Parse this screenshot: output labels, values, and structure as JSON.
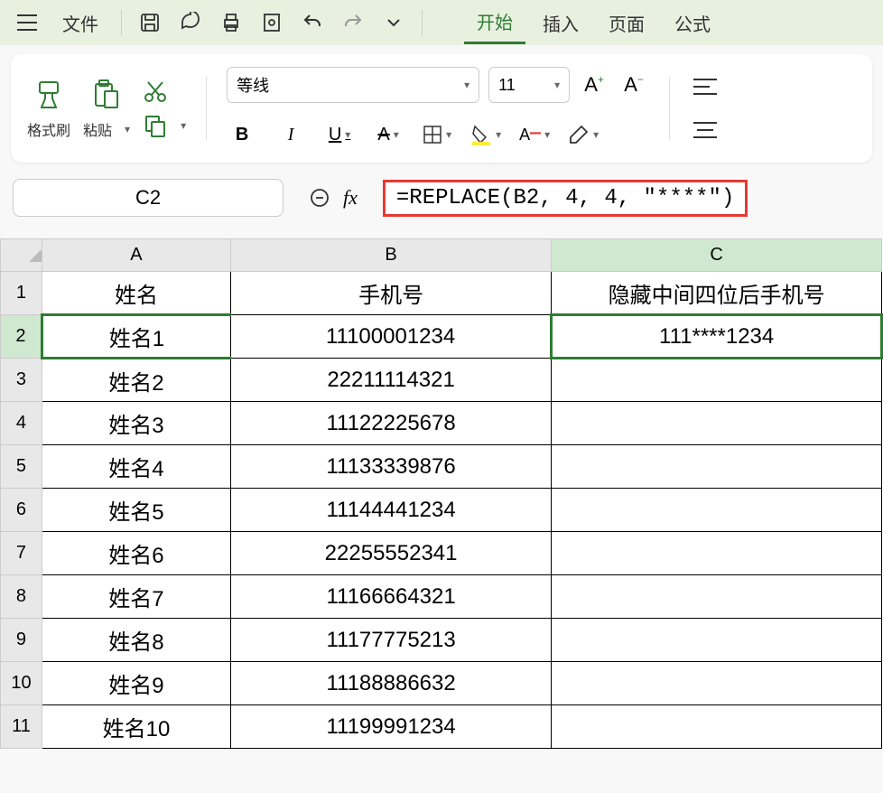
{
  "menu": {
    "file": "文件",
    "tabs": {
      "start": "开始",
      "insert": "插入",
      "page": "页面",
      "formula": "公式"
    }
  },
  "ribbon": {
    "format_painter": "格式刷",
    "paste": "粘贴",
    "font_name": "等线",
    "font_size": "11"
  },
  "formula_bar": {
    "cell_ref": "C2",
    "formula": "=REPLACE(B2, 4, 4, \"****\")"
  },
  "columns": [
    "A",
    "B",
    "C"
  ],
  "headers": {
    "a": "姓名",
    "b": "手机号",
    "c": "隐藏中间四位后手机号"
  },
  "rows": [
    {
      "n": "1"
    },
    {
      "n": "2",
      "a": "姓名1",
      "b": "11100001234",
      "c": "111****1234"
    },
    {
      "n": "3",
      "a": "姓名2",
      "b": "22211114321",
      "c": ""
    },
    {
      "n": "4",
      "a": "姓名3",
      "b": "11122225678",
      "c": ""
    },
    {
      "n": "5",
      "a": "姓名4",
      "b": "11133339876",
      "c": ""
    },
    {
      "n": "6",
      "a": "姓名5",
      "b": "11144441234",
      "c": ""
    },
    {
      "n": "7",
      "a": "姓名6",
      "b": "22255552341",
      "c": ""
    },
    {
      "n": "8",
      "a": "姓名7",
      "b": "11166664321",
      "c": ""
    },
    {
      "n": "9",
      "a": "姓名8",
      "b": "11177775213",
      "c": ""
    },
    {
      "n": "10",
      "a": "姓名9",
      "b": "11188886632",
      "c": ""
    },
    {
      "n": "11",
      "a": "姓名10",
      "b": "11199991234",
      "c": ""
    }
  ]
}
